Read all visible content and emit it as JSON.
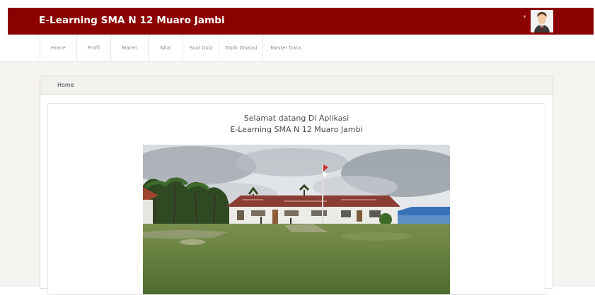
{
  "header": {
    "brand": "E-Learning SMA N 12 Muaro Jambi"
  },
  "nav": {
    "items": [
      {
        "label": "Home"
      },
      {
        "label": "Profil"
      },
      {
        "label": "Materi"
      },
      {
        "label": "Nilai"
      },
      {
        "label": "Soal Quiz"
      },
      {
        "label": "Topik Diskusi"
      },
      {
        "label": "Master Data"
      }
    ]
  },
  "breadcrumb": {
    "current": "Home"
  },
  "main": {
    "welcome_line1": "Selamat datang Di Aplikasi",
    "welcome_line2": "E-Learning SMA N 12 Muaro Jambi"
  },
  "colors": {
    "brand": "#8b0000",
    "page_bg": "#f6f4f0"
  },
  "icons": {
    "user_menu": "chevron-down-icon",
    "avatar": "user-avatar"
  }
}
